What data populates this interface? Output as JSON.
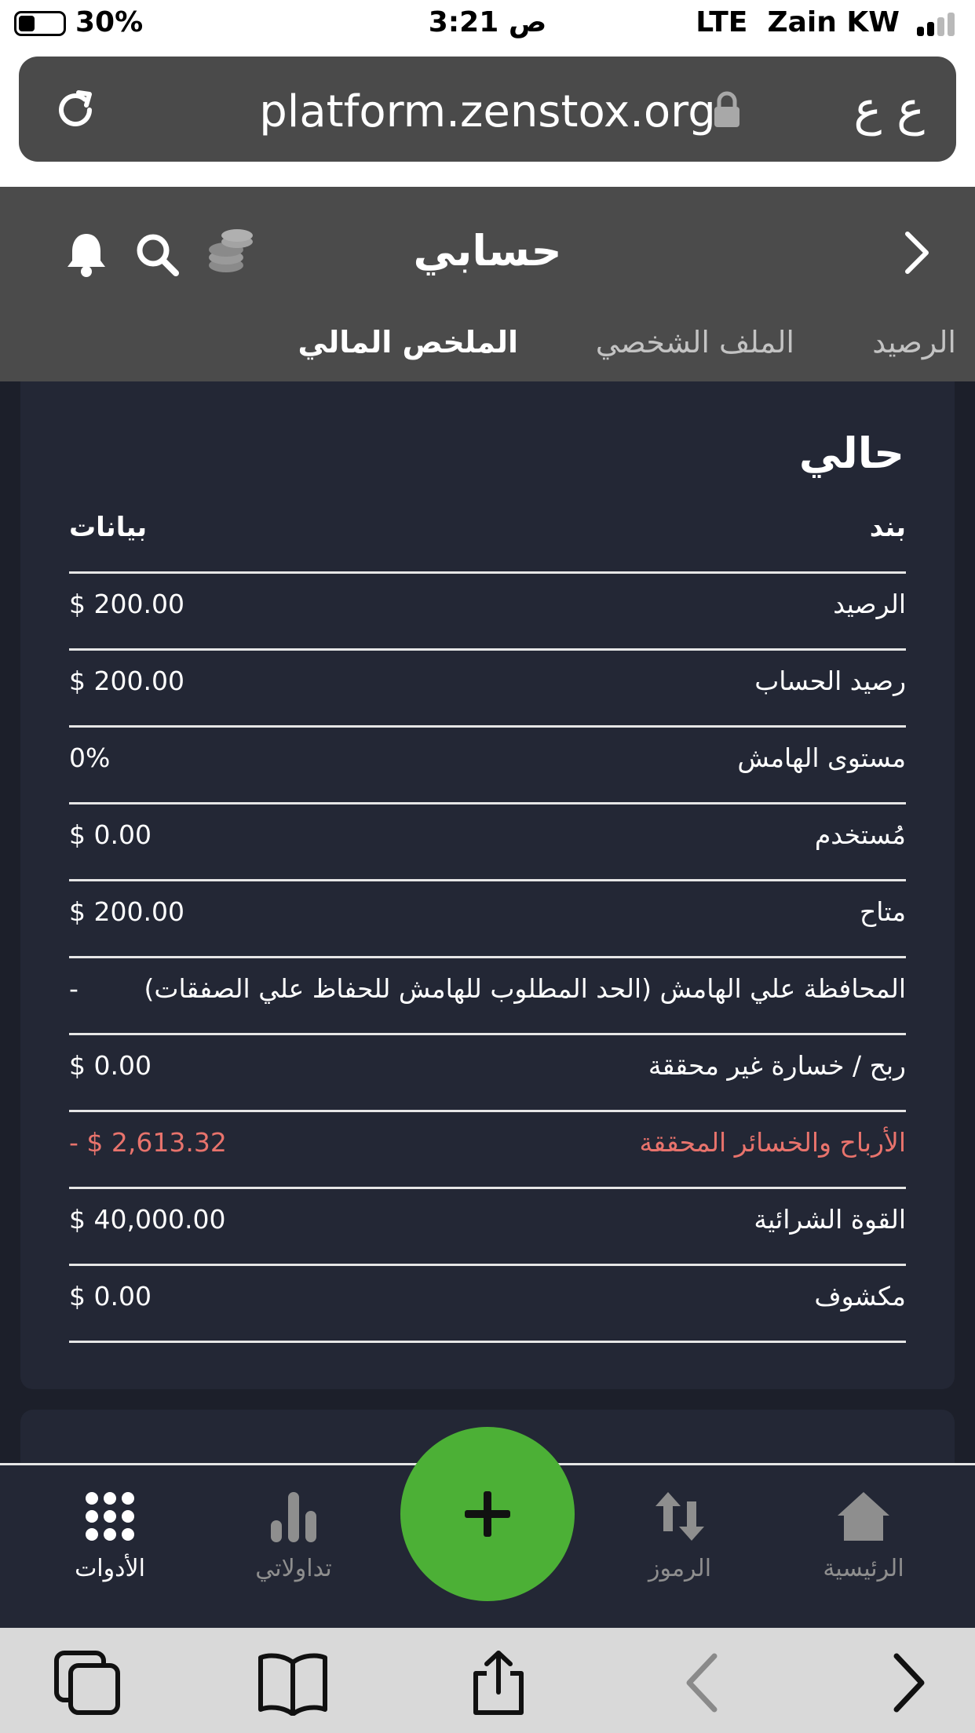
{
  "status_bar": {
    "battery_percent": "30%",
    "battery_level": 0.3,
    "time": "3:21 ص",
    "network": "LTE",
    "carrier": "Zain KW",
    "signal_bars": 2
  },
  "browser": {
    "url": "platform.zenstox.org",
    "text_size_button": "ع ع",
    "icons": [
      "reload-icon",
      "lock-icon"
    ]
  },
  "header": {
    "title": "حسابي",
    "icons": [
      "bell-icon",
      "search-icon",
      "coins-icon",
      "chevron-right-icon"
    ],
    "tabs": [
      {
        "label": "الرصيد",
        "active": false
      },
      {
        "label": "الملف الشخصي",
        "active": false
      },
      {
        "label": "الملخص المالي",
        "active": true
      }
    ]
  },
  "summary": {
    "heading": "حالي",
    "columns": {
      "item": "بند",
      "data": "بيانات"
    },
    "rows": [
      {
        "label": "الرصيد",
        "value": "$ 200.00"
      },
      {
        "label": "رصيد الحساب",
        "value": "$ 200.00"
      },
      {
        "label": "مستوى الهامش",
        "value": "0%"
      },
      {
        "label": "مُستخدم",
        "value": "$ 0.00"
      },
      {
        "label": "متاح",
        "value": "$ 200.00"
      },
      {
        "label": "المحافظة علي الهامش (الحد المطلوب للهامش للحفاظ علي الصفقات)",
        "value": "-"
      },
      {
        "label": "ربح / خسارة غير محققة",
        "value": "$ 0.00"
      },
      {
        "label": "الأرباح والخسائر المحققة",
        "value": "- $ 2,613.32",
        "color": "#e8736c"
      },
      {
        "label": "القوة الشرائية",
        "value": "$ 40,000.00"
      },
      {
        "label": "مكشوف",
        "value": "$ 0.00"
      }
    ]
  },
  "bottom_nav": {
    "items": [
      {
        "label": "الأدوات",
        "icon": "grid-icon",
        "active": true
      },
      {
        "label": "تداولاتي",
        "icon": "bar-chart-icon",
        "active": false
      },
      {
        "label": "الرموز",
        "icon": "up-down-arrows-icon",
        "active": false
      },
      {
        "label": "الرئيسية",
        "icon": "home-icon",
        "active": false
      }
    ],
    "fab_icon": "plus-icon",
    "fab_color": "#4cb036"
  },
  "safari_toolbar": {
    "icons": [
      "tabs-icon",
      "bookmarks-icon",
      "share-icon",
      "back-icon",
      "forward-icon"
    ]
  },
  "colors": {
    "background": "#1c1f2a",
    "card": "#232735",
    "header": "#4b4b4b",
    "negative": "#e8736c"
  }
}
